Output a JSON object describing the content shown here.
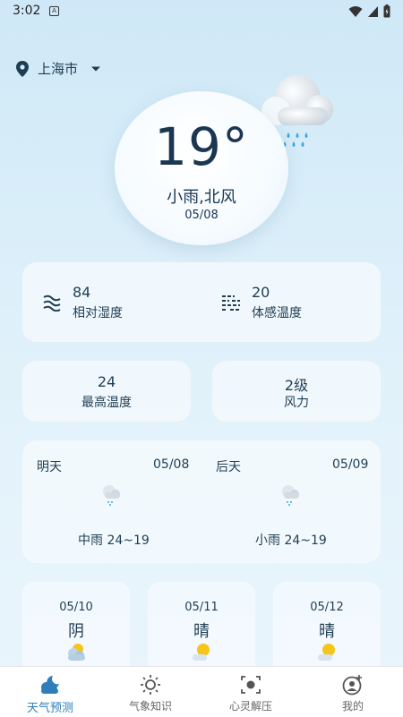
{
  "status_bar": {
    "time": "3:02",
    "notif_glyph": "A"
  },
  "location": {
    "city": "上海市"
  },
  "current": {
    "temperature": "19°",
    "condition": "小雨,北风",
    "date": "05/08"
  },
  "stats": {
    "humidity_value": "84",
    "humidity_label": "相对湿度",
    "feels_value": "20",
    "feels_label": "体感温度",
    "high_value": "24",
    "high_label": "最高温度",
    "wind_value": "2级",
    "wind_label": "风力"
  },
  "forecast": {
    "tomorrow": {
      "title": "明天",
      "date": "05/08",
      "condition": "中雨 24~19",
      "icon": "cloud-rain-icon"
    },
    "after": {
      "title": "后天",
      "date": "05/09",
      "condition": "小雨 24~19",
      "icon": "cloud-rain-icon"
    }
  },
  "days": [
    {
      "date": "05/10",
      "condition": "阴",
      "icon": "overcast-icon"
    },
    {
      "date": "05/11",
      "condition": "晴",
      "icon": "sunny-icon"
    },
    {
      "date": "05/12",
      "condition": "晴",
      "icon": "sunny-icon"
    }
  ],
  "nav": [
    {
      "label": "天气预测",
      "icon": "weather-forecast-icon",
      "active": true
    },
    {
      "label": "气象知识",
      "icon": "weather-knowledge-icon",
      "active": false
    },
    {
      "label": "心灵解压",
      "icon": "relax-icon",
      "active": false
    },
    {
      "label": "我的",
      "icon": "profile-icon",
      "active": false
    }
  ],
  "colors": {
    "accent": "#2c7fb8",
    "text": "#1f3d52",
    "rain": "#39a9e0",
    "sun": "#f5c518"
  }
}
